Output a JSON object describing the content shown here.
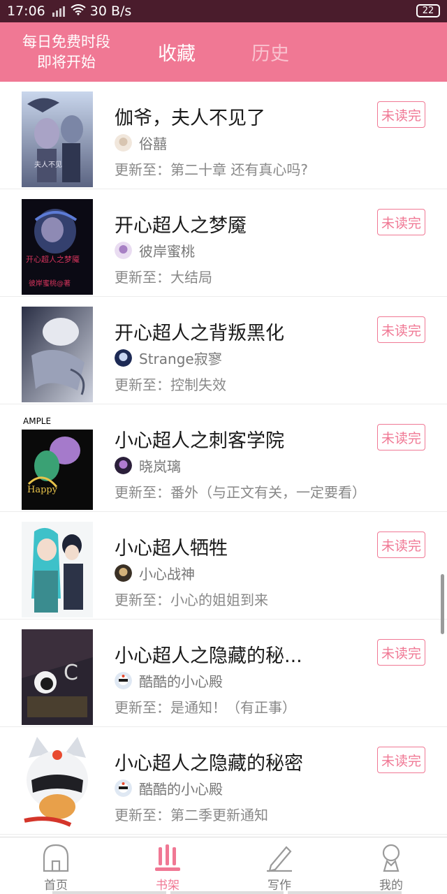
{
  "status_bar": {
    "time": "17:06",
    "speed": "30 B/s",
    "battery": "22"
  },
  "header": {
    "promo_line1": "每日免费时段",
    "promo_line2": "即将开始",
    "tab_active": "收藏",
    "tab_inactive": "历史",
    "colors": {
      "brand": "#f07894",
      "tab_inactive": "#f9c2cf"
    }
  },
  "list": {
    "items": [
      {
        "title": "伽爷，夫人不见了",
        "author": "俗囍",
        "update": "更新至：第二十章 还有真心吗?",
        "badge": "未读完"
      },
      {
        "title": "开心超人之梦魇",
        "author": "彼岸蜜桃",
        "update": "更新至：大结局",
        "badge": "未读完"
      },
      {
        "title": "开心超人之背叛黑化",
        "author": "Strange寂寥",
        "update": "更新至：控制失效",
        "badge": "未读完"
      },
      {
        "title": "小心超人之刺客学院",
        "author": "晓岚璃",
        "update": "更新至：番外（与正文有关，一定要看）",
        "badge": "未读完"
      },
      {
        "title": "小心超人牺牲",
        "author": "小心战神",
        "update": "更新至：小心的姐姐到来",
        "badge": "未读完"
      },
      {
        "title": "小心超人之隐藏的秘...",
        "author": "酷酷的小心殿",
        "update": "更新至：是通知！（有正事）",
        "badge": "未读完"
      },
      {
        "title": "小心超人之隐藏的秘密",
        "author": "酷酷的小心殿",
        "update": "更新至：第二季更新通知",
        "badge": "未读完"
      }
    ]
  },
  "bottom_nav": {
    "home": "首页",
    "bookshelf": "书架",
    "write": "写作",
    "mine": "我的",
    "active": "bookshelf"
  }
}
